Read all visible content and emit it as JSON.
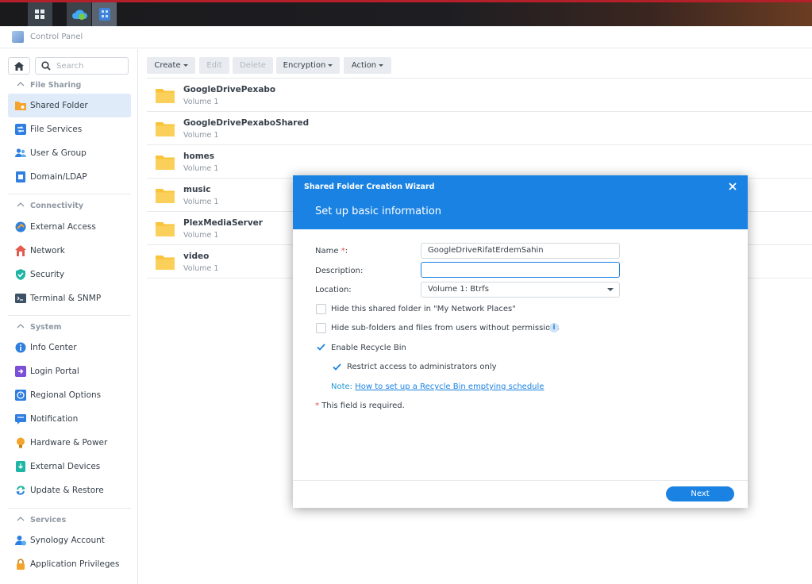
{
  "window": {
    "title": "Control Panel"
  },
  "sidebar": {
    "search_placeholder": "Search",
    "sections": [
      {
        "label": "File Sharing",
        "items": [
          "Shared Folder",
          "File Services",
          "User & Group",
          "Domain/LDAP"
        ]
      },
      {
        "label": "Connectivity",
        "items": [
          "External Access",
          "Network",
          "Security",
          "Terminal & SNMP"
        ]
      },
      {
        "label": "System",
        "items": [
          "Info Center",
          "Login Portal",
          "Regional Options",
          "Notification",
          "Hardware & Power",
          "External Devices",
          "Update & Restore"
        ]
      },
      {
        "label": "Services",
        "items": [
          "Synology Account",
          "Application Privileges"
        ]
      }
    ],
    "active_item": "Shared Folder"
  },
  "toolbar": {
    "create": "Create",
    "edit": "Edit",
    "delete": "Delete",
    "encryption": "Encryption",
    "action": "Action"
  },
  "folders": [
    {
      "name": "GoogleDrivePexabo",
      "volume": "Volume 1"
    },
    {
      "name": "GoogleDrivePexaboShared",
      "volume": "Volume 1"
    },
    {
      "name": "homes",
      "volume": "Volume 1"
    },
    {
      "name": "music",
      "volume": "Volume 1"
    },
    {
      "name": "PlexMediaServer",
      "volume": "Volume 1"
    },
    {
      "name": "video",
      "volume": "Volume 1"
    }
  ],
  "wizard": {
    "title": "Shared Folder Creation Wizard",
    "step_title": "Set up basic information",
    "name_label": "Name",
    "name_required_mark": "*",
    "name_label_colon": ":",
    "name_value": "GoogleDriveRifatErdemSahin",
    "description_label": "Description:",
    "description_value": "",
    "location_label": "Location:",
    "location_value": "Volume 1:  Btrfs",
    "opt_hide_network_places": "Hide this shared folder in \"My Network Places\"",
    "opt_hide_subfolders": "Hide sub-folders and files from users without permissions",
    "opt_enable_recycle": "Enable Recycle Bin",
    "opt_restrict_admins": "Restrict access to administrators only",
    "checked": {
      "hide_network_places": false,
      "hide_subfolders": false,
      "enable_recycle": true,
      "restrict_admins": true
    },
    "note_prefix": "Note:",
    "note_link": "How to set up a Recycle Bin emptying schedule",
    "required_note_mark": "*",
    "required_note": "This field is required.",
    "next": "Next"
  },
  "colors": {
    "accent": "#1a82e2",
    "folder": "#f9c33a",
    "active_bg": "#dfebf8"
  }
}
